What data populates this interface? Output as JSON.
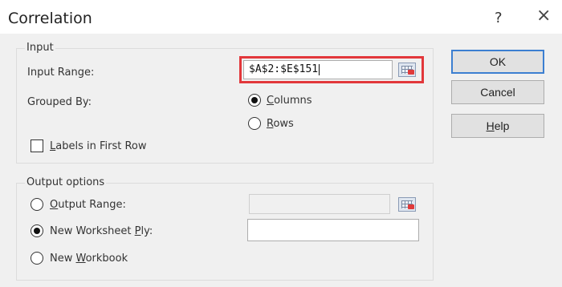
{
  "window": {
    "title": "Correlation",
    "help_glyph": "?",
    "close_glyph": "×"
  },
  "input_group": {
    "label": "Input",
    "input_range_label": "Input Range:",
    "input_range_value": "$A$2:$E$151",
    "grouped_by_label": "Grouped By:",
    "columns": {
      "label": "Columns",
      "accel": "C",
      "rest": "olumns",
      "selected": true
    },
    "rows": {
      "label": "Rows",
      "accel": "R",
      "rest": "ows",
      "selected": false
    },
    "labels_first_row": {
      "label": "Labels in First Row",
      "accel": "L",
      "rest": "abels in First Row",
      "checked": false
    }
  },
  "output_group": {
    "label": "Output options",
    "output_range": {
      "label": "Output Range:",
      "accel": "O",
      "rest": "utput Range:",
      "selected": false,
      "value": ""
    },
    "new_worksheet": {
      "label": "New Worksheet Ply:",
      "pre": "New Worksheet ",
      "accel": "P",
      "rest": "ly:",
      "selected": true,
      "value": ""
    },
    "new_workbook": {
      "label": "New Workbook",
      "pre": "New ",
      "accel": "W",
      "rest": "orkbook",
      "selected": false
    }
  },
  "buttons": {
    "ok": "OK",
    "cancel": "Cancel",
    "help": {
      "label": "Help",
      "accel": "H",
      "rest": "elp"
    }
  },
  "icons": {
    "refedit": "range-selector-icon",
    "highlight_color": "#e2373b",
    "default_button_border": "#3c7fd1"
  }
}
